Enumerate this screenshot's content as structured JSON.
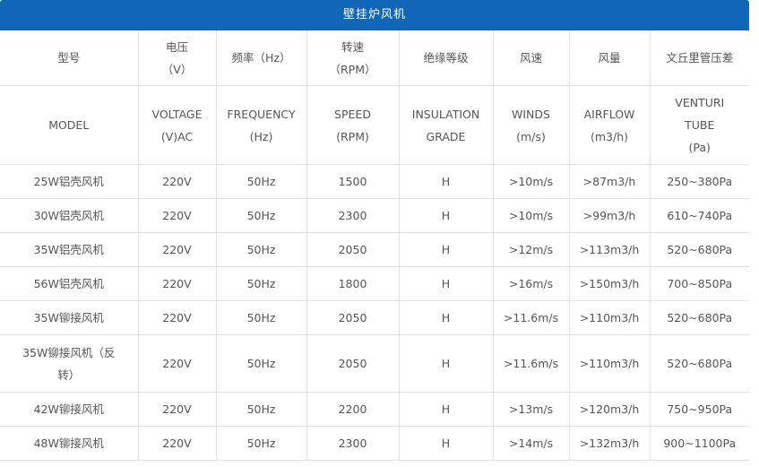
{
  "title": "壁挂炉风机",
  "header_cn": [
    [
      "型号"
    ],
    [
      "电压",
      "（V）"
    ],
    [
      "频率（Hz）"
    ],
    [
      "转速",
      "（RPM）"
    ],
    [
      "绝缘等级"
    ],
    [
      "风速"
    ],
    [
      "风量"
    ],
    [
      "文丘里管压差"
    ]
  ],
  "header_en": [
    [
      "MODEL"
    ],
    [
      "VOLTAGE",
      "(V)AC"
    ],
    [
      "FREQUENCY",
      "(Hz)"
    ],
    [
      "SPEED",
      "(RPM)"
    ],
    [
      "INSULATION",
      "GRADE"
    ],
    [
      "WINDS",
      "(m/s)"
    ],
    [
      "AIRFLOW",
      "(m3/h)"
    ],
    [
      "VENTURI",
      "TUBE",
      "(Pa)"
    ]
  ],
  "rows": [
    [
      "25W铝壳风机",
      "220V",
      "50Hz",
      "1500",
      "H",
      ">10m/s",
      ">87m3/h",
      "250~380Pa"
    ],
    [
      "30W铝壳风机",
      "220V",
      "50Hz",
      "2300",
      "H",
      ">10m/s",
      ">99m3/h",
      "610~740Pa"
    ],
    [
      "35W铝壳风机",
      "220V",
      "50Hz",
      "2050",
      "H",
      ">12m/s",
      ">113m3/h",
      "520~680Pa"
    ],
    [
      "56W铝壳风机",
      "220V",
      "50Hz",
      "1800",
      "H",
      ">16m/s",
      ">150m3/h",
      "700~850Pa"
    ],
    [
      "35W铆接风机",
      "220V",
      "50Hz",
      "2050",
      "H",
      ">11.6m/s",
      ">110m3/h",
      "520~680Pa"
    ],
    [
      "35W铆接风机（反转）",
      "220V",
      "50Hz",
      "2050",
      "H",
      ">11.6m/s",
      ">110m3/h",
      "520~680Pa"
    ],
    [
      "42W铆接风机",
      "220V",
      "50Hz",
      "2200",
      "H",
      ">13m/s",
      ">120m3/h",
      "750~950Pa"
    ],
    [
      "48W铆接风机",
      "220V",
      "50Hz",
      "2300",
      "H",
      ">14m/s",
      ">132m3/h",
      "900~1100Pa"
    ]
  ]
}
